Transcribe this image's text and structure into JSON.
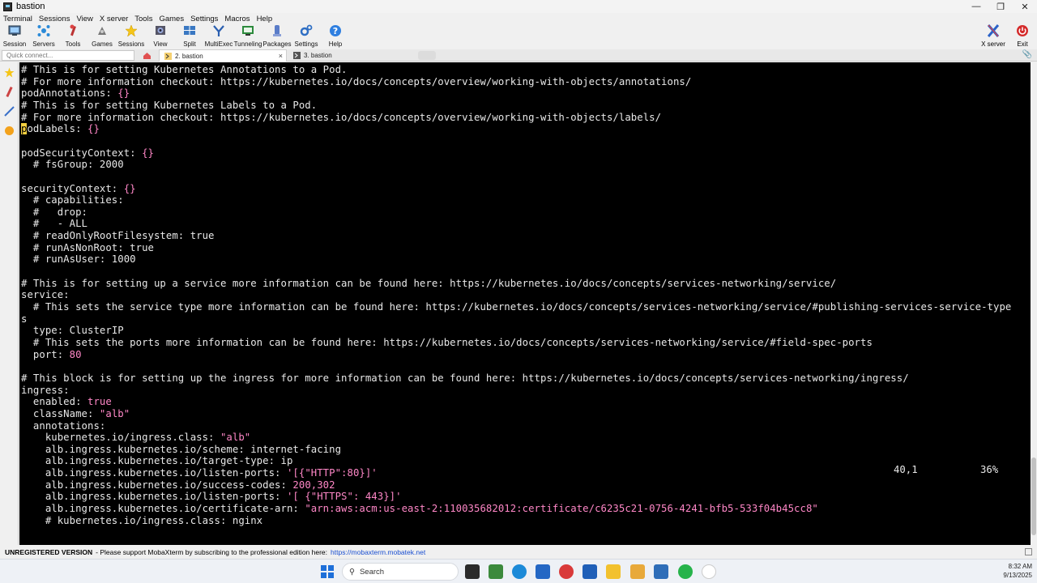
{
  "window": {
    "title": "bastion"
  },
  "menu": [
    "Terminal",
    "Sessions",
    "View",
    "X server",
    "Tools",
    "Games",
    "Settings",
    "Macros",
    "Help"
  ],
  "toolbar": {
    "tools": [
      {
        "label": "Session",
        "icon": "session-icon"
      },
      {
        "label": "Servers",
        "icon": "servers-icon"
      },
      {
        "label": "Tools",
        "icon": "tools-icon"
      },
      {
        "label": "Games",
        "icon": "games-icon"
      },
      {
        "label": "Sessions",
        "icon": "sessions-star-icon"
      },
      {
        "label": "View",
        "icon": "view-icon"
      },
      {
        "label": "Split",
        "icon": "split-icon"
      },
      {
        "label": "MultiExec",
        "icon": "multiexec-icon"
      },
      {
        "label": "Tunneling",
        "icon": "tunneling-icon"
      },
      {
        "label": "Packages",
        "icon": "packages-icon"
      },
      {
        "label": "Settings",
        "icon": "settings-icon"
      },
      {
        "label": "Help",
        "icon": "help-icon"
      }
    ],
    "xserver_label": "X server",
    "exit_label": "Exit"
  },
  "tabs": {
    "quick_connect_placeholder": "Quick connect...",
    "items": [
      {
        "label": "2. bastion",
        "active": true
      },
      {
        "label": "3. bastion",
        "active": false
      }
    ]
  },
  "terminal": {
    "lines": [
      [
        [
          "c-com",
          "# This is for setting Kubernetes Annotations to a Pod."
        ]
      ],
      [
        [
          "c-com",
          "# For more information checkout: https://kubernetes.io/docs/concepts/overview/working-with-objects/annotations/"
        ]
      ],
      [
        [
          "c-key",
          "podAnnotations: "
        ],
        [
          "c-val",
          "{}"
        ]
      ],
      [
        [
          "c-com",
          "# This is for setting Kubernetes Labels to a Pod."
        ]
      ],
      [
        [
          "c-com",
          "# For more information checkout: https://kubernetes.io/docs/concepts/overview/working-with-objects/labels/"
        ]
      ],
      [
        [
          "cursor",
          "p"
        ],
        [
          "c-key",
          "odLabels: "
        ],
        [
          "c-val",
          "{}"
        ]
      ],
      [
        [
          "c-plain",
          ""
        ]
      ],
      [
        [
          "c-key",
          "podSecurityContext: "
        ],
        [
          "c-val",
          "{}"
        ]
      ],
      [
        [
          "c-com",
          "  # fsGroup: 2000"
        ]
      ],
      [
        [
          "c-plain",
          ""
        ]
      ],
      [
        [
          "c-key",
          "securityContext: "
        ],
        [
          "c-val",
          "{}"
        ]
      ],
      [
        [
          "c-com",
          "  # capabilities:"
        ]
      ],
      [
        [
          "c-com",
          "  #   drop:"
        ]
      ],
      [
        [
          "c-com",
          "  #   - ALL"
        ]
      ],
      [
        [
          "c-com",
          "  # readOnlyRootFilesystem: true"
        ]
      ],
      [
        [
          "c-com",
          "  # runAsNonRoot: true"
        ]
      ],
      [
        [
          "c-com",
          "  # runAsUser: 1000"
        ]
      ],
      [
        [
          "c-plain",
          ""
        ]
      ],
      [
        [
          "c-com",
          "# This is for setting up a service more information can be found here: https://kubernetes.io/docs/concepts/services-networking/service/"
        ]
      ],
      [
        [
          "c-key",
          "service:"
        ]
      ],
      [
        [
          "c-com",
          "  # This sets the service type more information can be found here: https://kubernetes.io/docs/concepts/services-networking/service/#publishing-services-service-type"
        ]
      ],
      [
        [
          "c-com",
          "s"
        ]
      ],
      [
        [
          "c-key",
          "  type: "
        ],
        [
          "c-plain",
          "ClusterIP"
        ]
      ],
      [
        [
          "c-com",
          "  # This sets the ports more information can be found here: https://kubernetes.io/docs/concepts/services-networking/service/#field-spec-ports"
        ]
      ],
      [
        [
          "c-key",
          "  port: "
        ],
        [
          "c-val",
          "80"
        ]
      ],
      [
        [
          "c-plain",
          ""
        ]
      ],
      [
        [
          "c-com",
          "# This block is for setting up the ingress for more information can be found here: https://kubernetes.io/docs/concepts/services-networking/ingress/"
        ]
      ],
      [
        [
          "c-key",
          "ingress:"
        ]
      ],
      [
        [
          "c-key",
          "  enabled: "
        ],
        [
          "c-val",
          "true"
        ]
      ],
      [
        [
          "c-key",
          "  className: "
        ],
        [
          "c-str",
          "\"alb\""
        ]
      ],
      [
        [
          "c-key",
          "  annotations:"
        ]
      ],
      [
        [
          "c-key",
          "    kubernetes.io/ingress.class: "
        ],
        [
          "c-str",
          "\"alb\""
        ]
      ],
      [
        [
          "c-key",
          "    alb.ingress.kubernetes.io/scheme: "
        ],
        [
          "c-plain",
          "internet-facing"
        ]
      ],
      [
        [
          "c-key",
          "    alb.ingress.kubernetes.io/target-type: "
        ],
        [
          "c-plain",
          "ip"
        ]
      ],
      [
        [
          "c-key",
          "    alb.ingress.kubernetes.io/listen-ports: "
        ],
        [
          "c-str",
          "'[{\"HTTP\":80}]'"
        ]
      ],
      [
        [
          "c-key",
          "    alb.ingress.kubernetes.io/success-codes: "
        ],
        [
          "c-val",
          "200,302"
        ]
      ],
      [
        [
          "c-key",
          "    alb.ingress.kubernetes.io/listen-ports: "
        ],
        [
          "c-str",
          "'[ {\"HTTPS\": 443}]'"
        ]
      ],
      [
        [
          "c-key",
          "    alb.ingress.kubernetes.io/certificate-arn: "
        ],
        [
          "c-str",
          "\"arn:aws:acm:us-east-2:110035682012:certificate/c6235c21-0756-4241-bfb5-533f04b45cc8\""
        ]
      ],
      [
        [
          "c-com",
          "    # kubernetes.io/ingress.class: nginx"
        ]
      ]
    ],
    "status_position": "40,1",
    "status_percent": "36%"
  },
  "unregistered": {
    "label": "UNREGISTERED VERSION",
    "message": "-  Please support MobaXterm by subscribing to the professional edition here:",
    "link": "https://mobaxterm.mobatek.net"
  },
  "taskbar": {
    "search_label": "Search",
    "time": "8:32 AM",
    "date": "9/13/2025"
  }
}
